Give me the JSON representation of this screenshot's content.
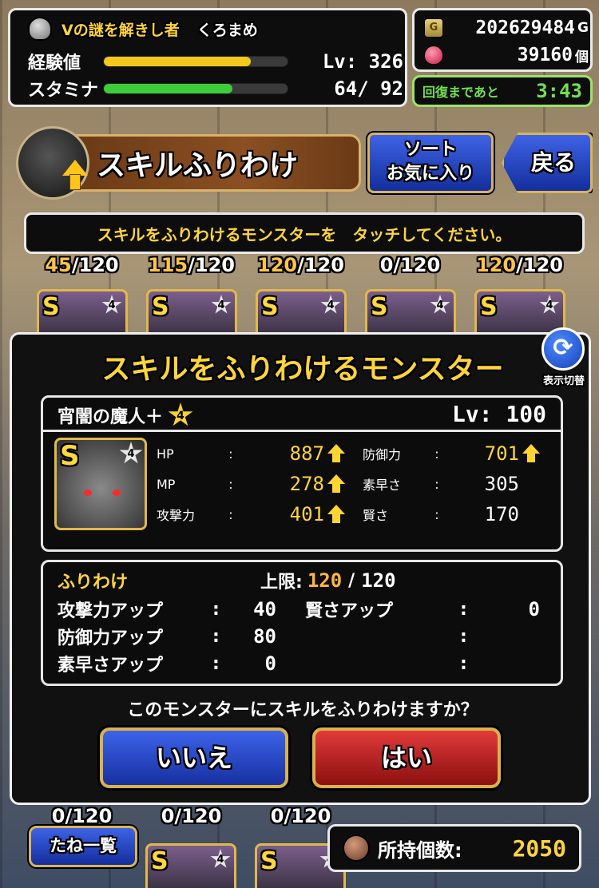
{
  "status": {
    "title": "Vの謎を解きし者",
    "player_name": "くろまめ",
    "exp_label": "経験値",
    "exp_fill": 0.8,
    "level_text": "Lv: 326",
    "stamina_label": "スタミナ",
    "stamina_current": "64",
    "stamina_max": "92",
    "stamina_fill": 0.7,
    "exp_color": "#f2c81c",
    "stamina_color": "#3fcc3a"
  },
  "currency": {
    "gold_icon_letter": "G",
    "gold": "202629484",
    "gold_unit": "G",
    "gems": "39160",
    "gems_unit": "個"
  },
  "recovery": {
    "label": "回復まであと",
    "time": "3:43"
  },
  "header": {
    "title": "スキルふりわけ"
  },
  "buttons": {
    "sort_line1": "ソート",
    "sort_line2": "お気に入り",
    "back": "戻る",
    "toggle_label": "表示切替",
    "no": "いいえ",
    "yes": "はい",
    "seed_list": "たね一覧"
  },
  "instruction": "スキルをふりわけるモンスターを　タッチしてください。",
  "grid": {
    "counts": [
      {
        "cur": "45",
        "max": "/120"
      },
      {
        "cur": "115",
        "max": "/120"
      },
      {
        "cur": "120",
        "max": "/120"
      },
      {
        "cur": "0",
        "max": "/120"
      },
      {
        "cur": "120",
        "max": "/120"
      }
    ],
    "bottom_counts": [
      "0/120",
      "0/120",
      "0/120"
    ],
    "card_rank": "S",
    "card_star": "4"
  },
  "modal": {
    "title": "スキルをふりわけるモンスター",
    "monster_name": "宵闇の魔人＋",
    "rank": "S",
    "star": "4",
    "level": "Lv: 100",
    "stats_left": [
      {
        "name": "HP",
        "value": "887",
        "up": true
      },
      {
        "name": "MP",
        "value": "278",
        "up": true
      },
      {
        "name": "攻撃力",
        "value": "401",
        "up": true
      }
    ],
    "stats_right": [
      {
        "name": "防御力",
        "value": "701",
        "up": true
      },
      {
        "name": "素早さ",
        "value": "305",
        "up": false
      },
      {
        "name": "賢さ",
        "value": "170",
        "up": false
      }
    ],
    "allocation": {
      "label": "ふりわけ",
      "limit_label": "上限:",
      "limit_current": "120",
      "limit_max": "120",
      "rows_left": [
        {
          "name": "攻撃力アップ",
          "value": "40"
        },
        {
          "name": "防御力アップ",
          "value": "80"
        },
        {
          "name": "素早さアップ",
          "value": "0"
        }
      ],
      "rows_right": [
        {
          "name": "賢さアップ",
          "value": "0"
        }
      ]
    },
    "question": "このモンスターにスキルをふりわけますか？"
  },
  "owned": {
    "label": "所持個数:",
    "value": "2050"
  }
}
